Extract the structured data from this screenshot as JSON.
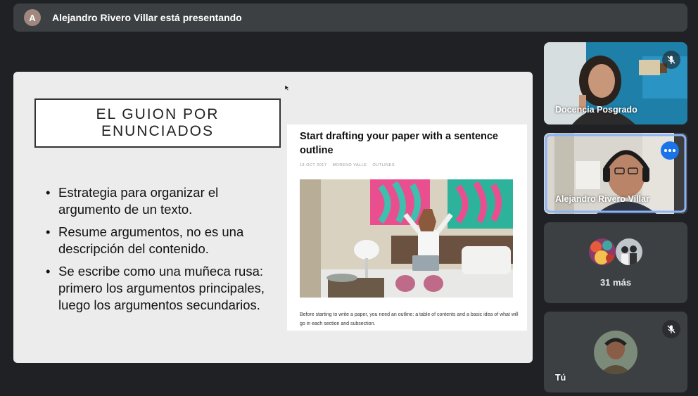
{
  "topbar": {
    "avatar_letter": "A",
    "text": "Alejandro Rivero Villar está presentando"
  },
  "slide": {
    "title_line1": "EL GUION POR",
    "title_line2": "ENUNCIADOS",
    "bullets": [
      "Estrategia para organizar el argumento de un texto.",
      "Resume argumentos, no es una descripción del contenido.",
      "Se escribe como una muñeca rusa: primero los argumentos principales, luego los argumentos secundarios."
    ],
    "article": {
      "title": "Start drafting your paper with a sentence outline",
      "meta_date": "18 OCT 2017",
      "meta_author": "MORENO VALLE",
      "meta_category": "OUTLINES",
      "body": "Before starting to write a paper, you need an outline: a table of contents and a basic idea of what will go in each section and subsection."
    }
  },
  "participants": {
    "tile1_name": "Docencia Posgrado",
    "tile2_name": "Alejandro Rivero Villar",
    "tile3_more": "31 más",
    "tile4_name": "Tú"
  },
  "colors": {
    "background": "#202124",
    "tile": "#3c4043",
    "accent_blue": "#1a73e8",
    "active_border": "#8ab4f8"
  },
  "icons": [
    "mic-off-icon",
    "more-options-icon",
    "cursor-icon"
  ]
}
